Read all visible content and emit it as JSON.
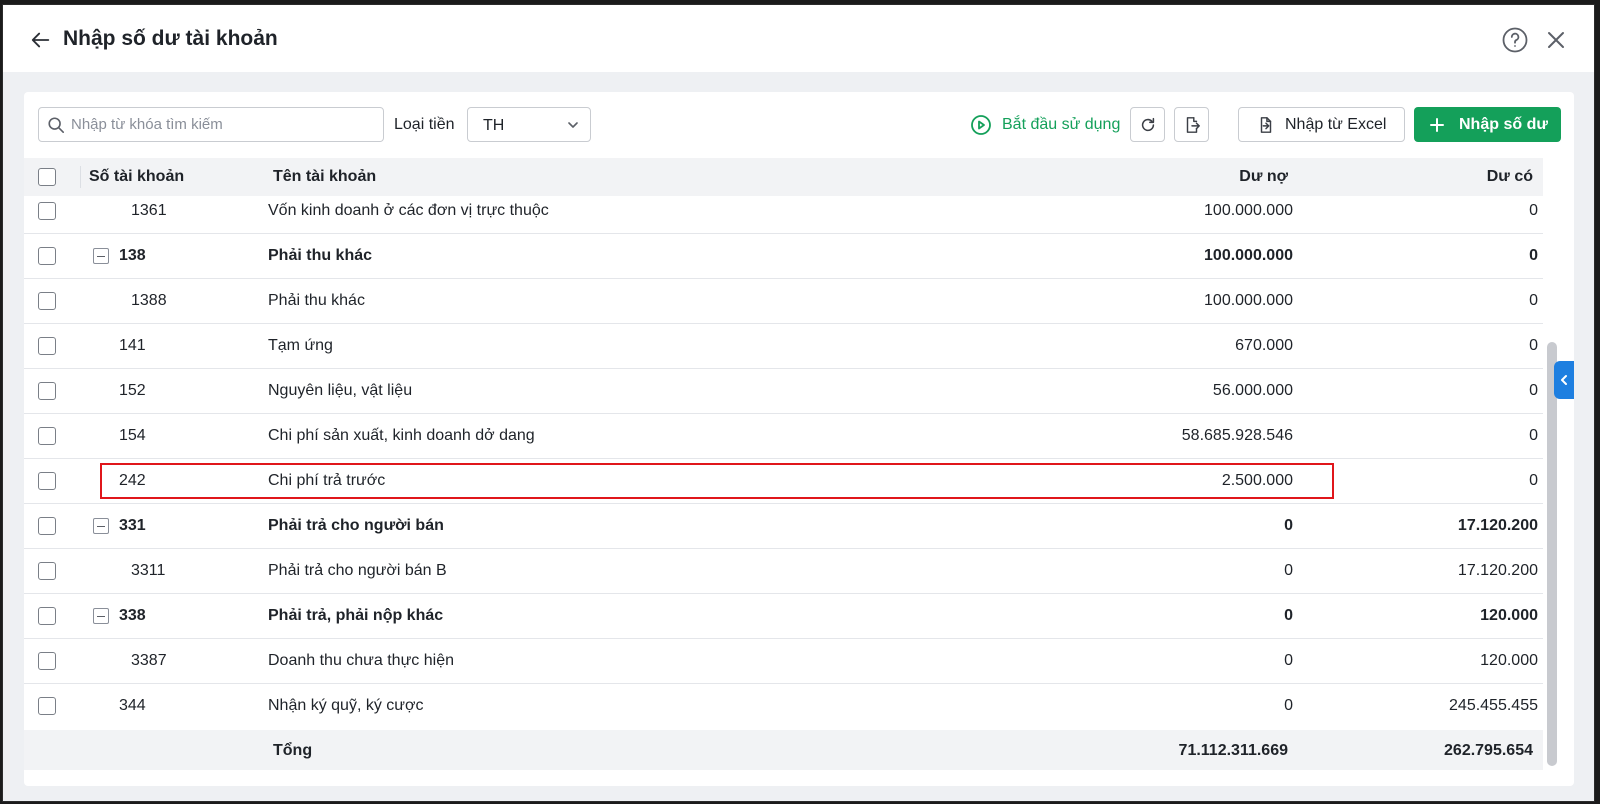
{
  "header": {
    "title": "Nhập số dư tài khoản"
  },
  "toolbar": {
    "search_placeholder": "Nhập từ khóa tìm kiếm",
    "currency_label": "Loại tiền",
    "currency_value": "TH",
    "start_label": "Bắt đầu sử dụng",
    "import_excel_label": "Nhập từ Excel",
    "add_balance_label": "Nhập số dư"
  },
  "table": {
    "headers": {
      "account_no": "Số tài khoản",
      "account_name": "Tên tài khoản",
      "debit": "Dư nợ",
      "credit": "Dư có"
    },
    "rows": [
      {
        "account": "1361",
        "name": "Vốn kinh doanh ở các đơn vị trực thuộc",
        "debit": "100.000.000",
        "credit": "0",
        "level": 2,
        "bold": false,
        "collapsible": false
      },
      {
        "account": "138",
        "name": "Phải thu khác",
        "debit": "100.000.000",
        "credit": "0",
        "level": 1,
        "bold": true,
        "collapsible": true
      },
      {
        "account": "1388",
        "name": "Phải thu khác",
        "debit": "100.000.000",
        "credit": "0",
        "level": 2,
        "bold": false,
        "collapsible": false
      },
      {
        "account": "141",
        "name": "Tạm ứng",
        "debit": "670.000",
        "credit": "0",
        "level": 1,
        "bold": false,
        "collapsible": false
      },
      {
        "account": "152",
        "name": "Nguyên liệu, vật liệu",
        "debit": "56.000.000",
        "credit": "0",
        "level": 1,
        "bold": false,
        "collapsible": false
      },
      {
        "account": "154",
        "name": "Chi phí sản xuất, kinh doanh dở dang",
        "debit": "58.685.928.546",
        "credit": "0",
        "level": 1,
        "bold": false,
        "collapsible": false
      },
      {
        "account": "242",
        "name": "Chi phí trả trước",
        "debit": "2.500.000",
        "credit": "0",
        "level": 1,
        "bold": false,
        "collapsible": false,
        "highlighted": true
      },
      {
        "account": "331",
        "name": "Phải trả cho người bán",
        "debit": "0",
        "credit": "17.120.200",
        "level": 1,
        "bold": true,
        "collapsible": true
      },
      {
        "account": "3311",
        "name": "Phải trả cho người bán B",
        "debit": "0",
        "credit": "17.120.200",
        "level": 2,
        "bold": false,
        "collapsible": false
      },
      {
        "account": "338",
        "name": "Phải trả, phải nộp khác",
        "debit": "0",
        "credit": "120.000",
        "level": 1,
        "bold": true,
        "collapsible": true
      },
      {
        "account": "3387",
        "name": "Doanh thu chưa thực hiện",
        "debit": "0",
        "credit": "120.000",
        "level": 2,
        "bold": false,
        "collapsible": false
      },
      {
        "account": "344",
        "name": "Nhận ký quỹ, ký cược",
        "debit": "0",
        "credit": "245.455.455",
        "level": 1,
        "bold": false,
        "collapsible": false
      }
    ],
    "footer": {
      "label": "Tổng",
      "debit": "71.112.311.669",
      "credit": "262.795.654"
    }
  },
  "colors": {
    "accent": "#14a05a",
    "highlight": "#e0161b",
    "side_tab": "#1e7fe0"
  }
}
